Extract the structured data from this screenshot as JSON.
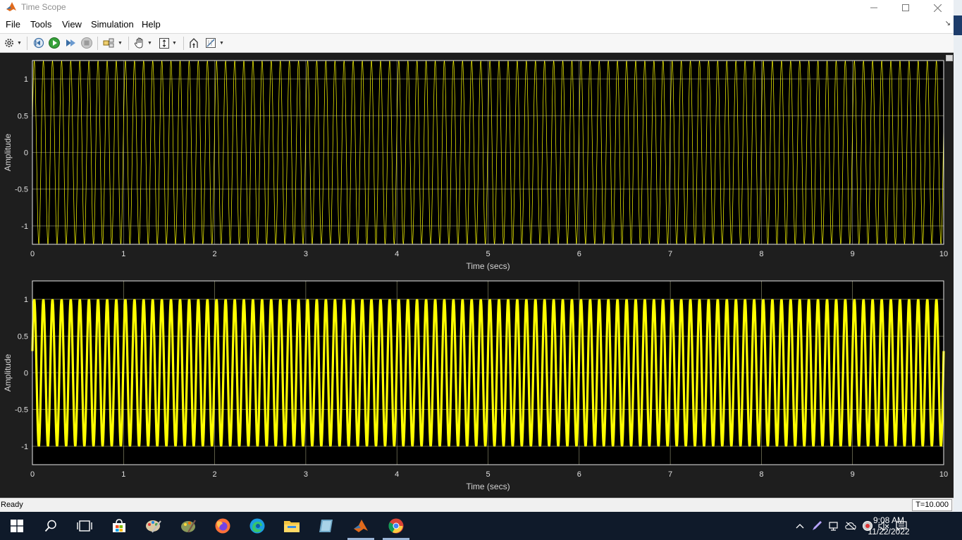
{
  "window": {
    "title": "Time Scope"
  },
  "menu": [
    "File",
    "Tools",
    "View",
    "Simulation",
    "Help"
  ],
  "toolbar_icons": [
    "gear-icon",
    "step-back-icon",
    "run-icon",
    "step-forward-icon",
    "stop-icon",
    "config-icon",
    "pan-icon",
    "zoom-axes-icon",
    "autoscale-icon",
    "measure-icon"
  ],
  "status": {
    "text": "Ready",
    "time_readout": "T=10.000"
  },
  "clock": {
    "time": "9:08 AM",
    "date": "11/22/2022"
  },
  "colors": {
    "signal": "#ffff00",
    "axes_bg": "#000000",
    "grid": "#d9d9a8",
    "figure_bg": "#1e1e1e"
  },
  "chart_data": [
    {
      "type": "line",
      "title": "",
      "xlabel": "Time (secs)",
      "ylabel": "Amplitude",
      "xlim": [
        0,
        10
      ],
      "ylim": [
        -1.25,
        1.25
      ],
      "x_ticks": [
        "0",
        "1",
        "2",
        "3",
        "4",
        "5",
        "6",
        "7",
        "8",
        "9",
        "10"
      ],
      "y_ticks": [
        "-1",
        "-0.5",
        "0",
        "0.5",
        "1"
      ],
      "grid": true,
      "series": [
        {
          "frequency_hz": 10,
          "amplitude": 1.25
        }
      ]
    },
    {
      "type": "line",
      "title": "",
      "xlabel": "Time (secs)",
      "ylabel": "Amplitude",
      "xlim": [
        0,
        10
      ],
      "ylim": [
        -1.25,
        1.25
      ],
      "x_ticks": [
        "0",
        "1",
        "2",
        "3",
        "4",
        "5",
        "6",
        "7",
        "8",
        "9",
        "10"
      ],
      "y_ticks": [
        "-1",
        "-0.5",
        "0",
        "0.5",
        "1"
      ],
      "grid": true,
      "series": [
        {
          "frequency_hz": 10,
          "amplitude": 1.0
        }
      ]
    }
  ]
}
